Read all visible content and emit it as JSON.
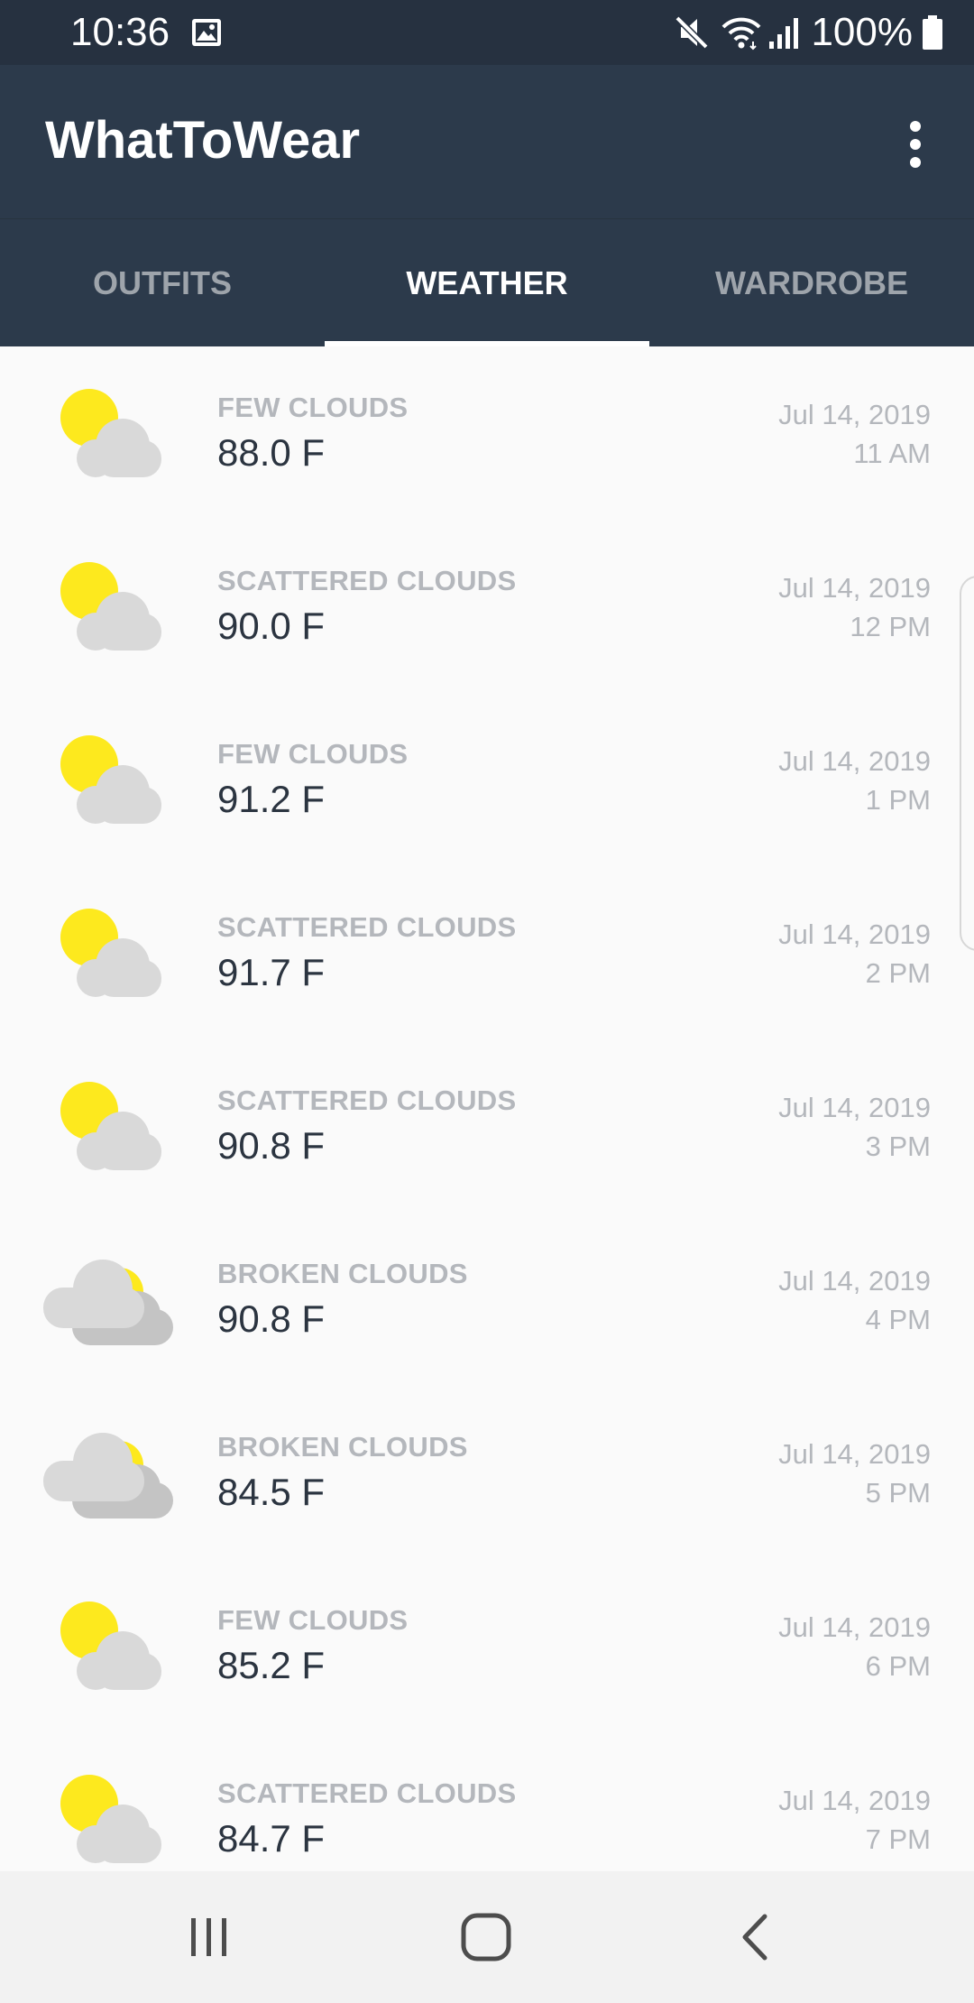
{
  "status_bar": {
    "time": "10:36",
    "battery": "100%",
    "icons": [
      "image-icon",
      "mute-icon",
      "wifi-icon",
      "signal-icon",
      "battery-icon"
    ]
  },
  "app_bar": {
    "title": "WhatToWear",
    "menu_icon": "overflow-menu-icon"
  },
  "tabs": [
    {
      "label": "OUTFITS",
      "active": false
    },
    {
      "label": "WEATHER",
      "active": true
    },
    {
      "label": "WARDROBE",
      "active": false
    }
  ],
  "forecast": [
    {
      "icon": "few-clouds-icon",
      "condition": "FEW CLOUDS",
      "temp": "88.0 F",
      "date": "Jul 14, 2019",
      "time": "11 AM"
    },
    {
      "icon": "scattered-clouds-icon",
      "condition": "SCATTERED CLOUDS",
      "temp": "90.0 F",
      "date": "Jul 14, 2019",
      "time": "12 PM"
    },
    {
      "icon": "few-clouds-icon",
      "condition": "FEW CLOUDS",
      "temp": "91.2 F",
      "date": "Jul 14, 2019",
      "time": "1 PM"
    },
    {
      "icon": "scattered-clouds-icon",
      "condition": "SCATTERED CLOUDS",
      "temp": "91.7 F",
      "date": "Jul 14, 2019",
      "time": "2 PM"
    },
    {
      "icon": "scattered-clouds-icon",
      "condition": "SCATTERED CLOUDS",
      "temp": "90.8 F",
      "date": "Jul 14, 2019",
      "time": "3 PM"
    },
    {
      "icon": "broken-clouds-icon",
      "condition": "BROKEN CLOUDS",
      "temp": "90.8 F",
      "date": "Jul 14, 2019",
      "time": "4 PM"
    },
    {
      "icon": "broken-clouds-icon",
      "condition": "BROKEN CLOUDS",
      "temp": "84.5 F",
      "date": "Jul 14, 2019",
      "time": "5 PM"
    },
    {
      "icon": "few-clouds-icon",
      "condition": "FEW CLOUDS",
      "temp": "85.2 F",
      "date": "Jul 14, 2019",
      "time": "6 PM"
    },
    {
      "icon": "scattered-clouds-icon",
      "condition": "SCATTERED CLOUDS",
      "temp": "84.7 F",
      "date": "Jul 14, 2019",
      "time": "7 PM"
    }
  ],
  "nav_bar": {
    "buttons": [
      "recent-apps-icon",
      "home-icon",
      "back-icon"
    ]
  },
  "colors": {
    "status_bar": "#263140",
    "app_bar": "#2c3a4b",
    "tab_active": "#ffffff",
    "tab_inactive": "#9ea4ab",
    "list_background": "#fafafa",
    "condition_text": "#b4b7bc",
    "temp_text": "#2b3440",
    "sun": "#fde91e",
    "cloud_light": "#d9d9d9",
    "cloud_dark": "#c4c4c4"
  }
}
